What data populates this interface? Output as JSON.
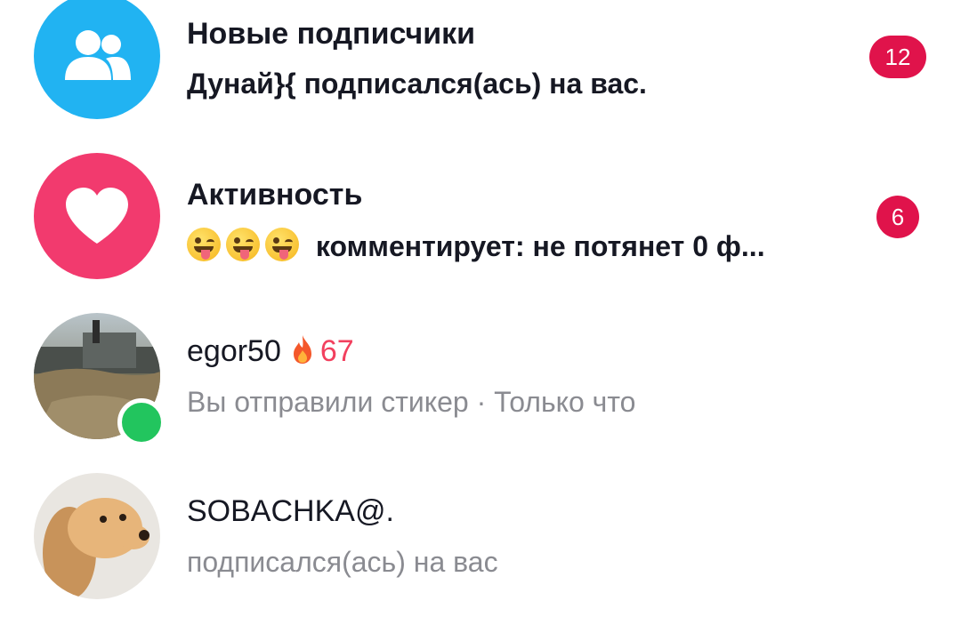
{
  "rows": [
    {
      "title": "Новые подписчики",
      "subtitle": "Дунай}{ подписался(ась) на вас.",
      "badge": "12",
      "icon": "followers-icon",
      "color": "#21b3f2"
    },
    {
      "title": "Активность",
      "subtitle": "комментирует: не потянет 0 ф...",
      "emoji": "😜😜😜",
      "badge": "6",
      "icon": "heart-icon",
      "color": "#f23a6e"
    },
    {
      "name": "egor50",
      "streak": "67",
      "status": "Вы отправили стикер · Только что",
      "online": true,
      "icon": "fire-icon"
    },
    {
      "name": "SOBACHKA@.",
      "status": "подписался(ась) на вас"
    }
  ],
  "colors": {
    "badge": "#e0134b",
    "online": "#22c55e",
    "muted_text": "#8a8b91",
    "streak": "#f2405e"
  }
}
